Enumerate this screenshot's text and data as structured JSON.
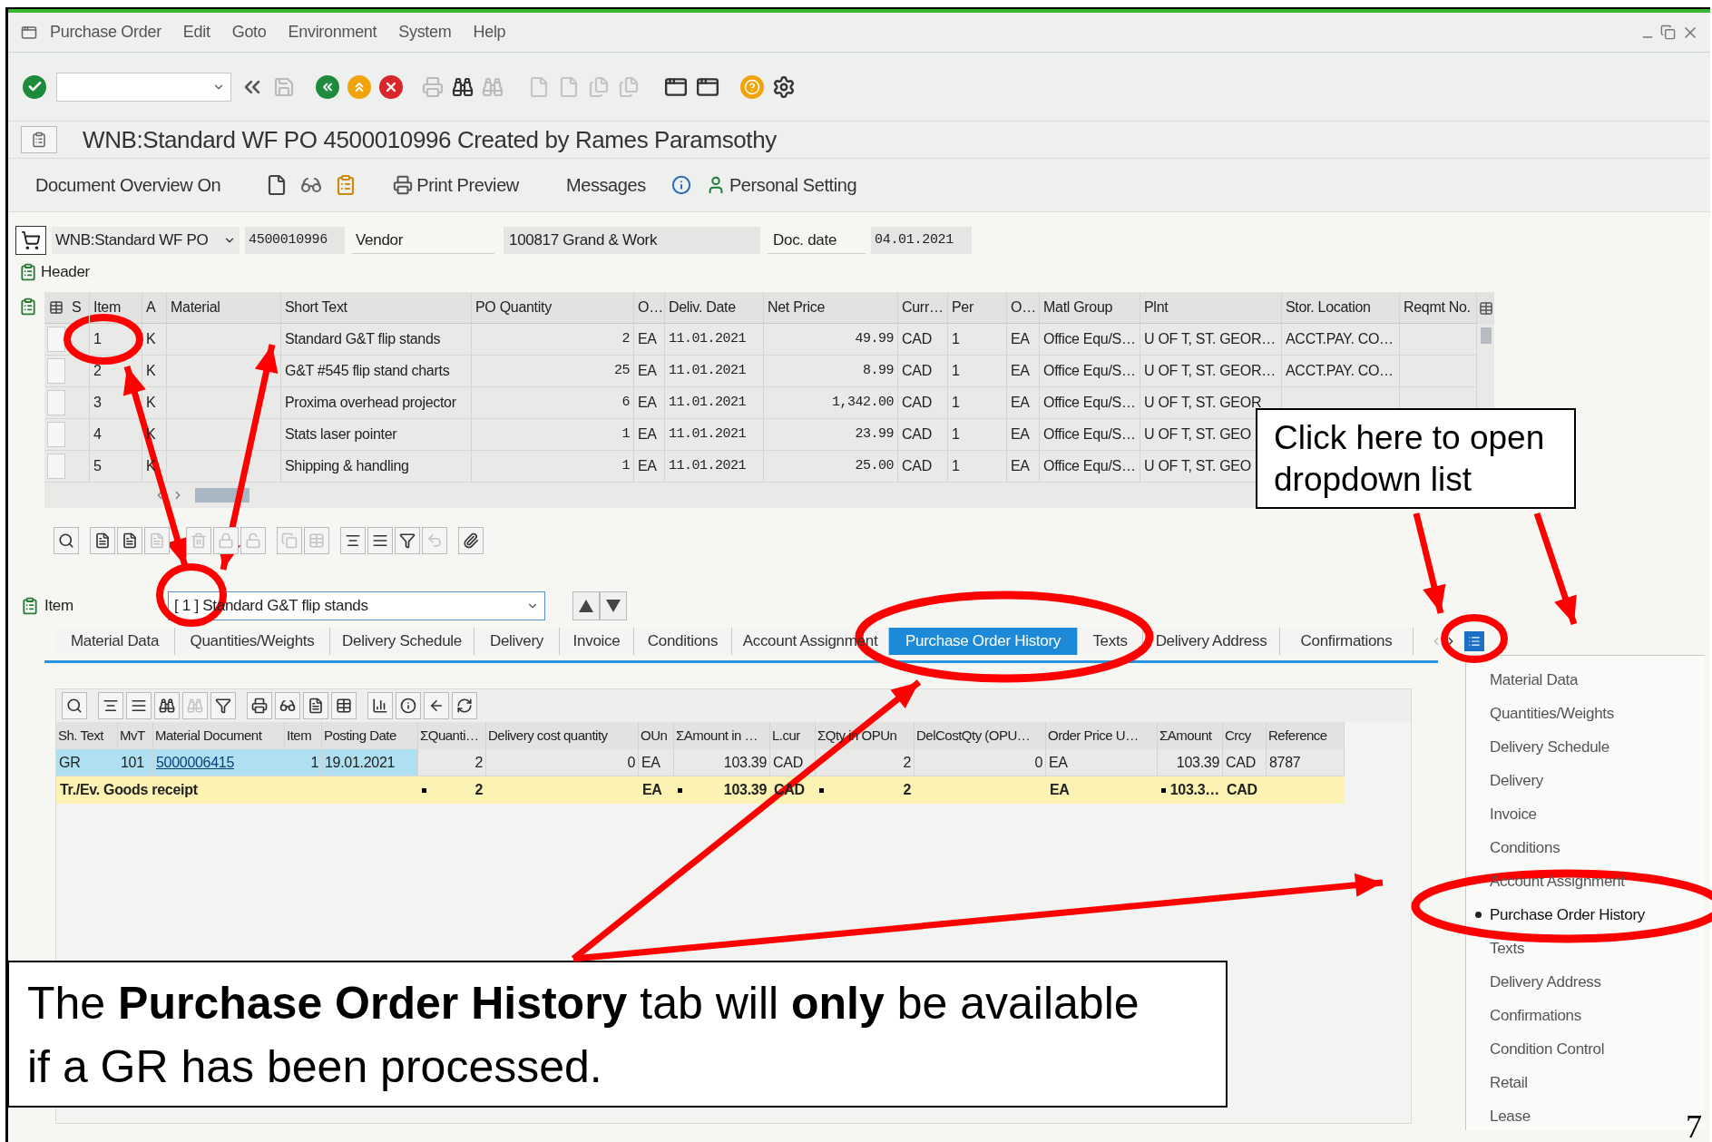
{
  "menu_bar": {
    "items": [
      "Purchase Order",
      "Edit",
      "Goto",
      "Environment",
      "System",
      "Help"
    ]
  },
  "title": "WNB:Standard WF PO 4500010996 Created by Rames Paramsothy",
  "app_toolbar": {
    "items": [
      "Document Overview On",
      "Print Preview",
      "Messages",
      "Personal Setting"
    ]
  },
  "header": {
    "doc_type": "WNB:Standard WF PO",
    "po_number": "4500010996",
    "vendor_label": "Vendor",
    "vendor": "100817 Grand & Work",
    "doc_date_label": "Doc. date",
    "doc_date": "04.01.2021",
    "section_label": "Header"
  },
  "items_table": {
    "columns": [
      "S",
      "Item",
      "A",
      "Material",
      "Short Text",
      "PO Quantity",
      "O…",
      "Deliv. Date",
      "Net Price",
      "Curr…",
      "Per",
      "O…",
      "Matl Group",
      "Plnt",
      "Stor. Location",
      "Reqmt No."
    ],
    "rows": [
      {
        "item": "1",
        "a": "K",
        "short_text": "Standard G&T flip stands",
        "po_quantity": "2",
        "order_unit": "EA",
        "deliv_date": "11.01.2021",
        "net_price": "49.99",
        "currency": "CAD",
        "per": "1",
        "order_price_unit": "EA",
        "matl_group": "Office Equ/S…",
        "plant": "U OF T, ST. GEOR…",
        "stor_location": "ACCT.PAY. CO…"
      },
      {
        "item": "2",
        "a": "K",
        "short_text": "G&T #545 flip stand charts",
        "po_quantity": "25",
        "order_unit": "EA",
        "deliv_date": "11.01.2021",
        "net_price": "8.99",
        "currency": "CAD",
        "per": "1",
        "order_price_unit": "EA",
        "matl_group": "Office Equ/S…",
        "plant": "U OF T, ST. GEOR…",
        "stor_location": "ACCT.PAY. CO…"
      },
      {
        "item": "3",
        "a": "K",
        "short_text": "Proxima overhead projector",
        "po_quantity": "6",
        "order_unit": "EA",
        "deliv_date": "11.01.2021",
        "net_price": "1,342.00",
        "currency": "CAD",
        "per": "1",
        "order_price_unit": "EA",
        "matl_group": "Office Equ/S…",
        "plant": "U OF T, ST. GEOR"
      },
      {
        "item": "4",
        "a": "K",
        "short_text": "Stats laser pointer",
        "po_quantity": "1",
        "order_unit": "EA",
        "deliv_date": "11.01.2021",
        "net_price": "23.99",
        "currency": "CAD",
        "per": "1",
        "order_price_unit": "EA",
        "matl_group": "Office Equ/S…",
        "plant": "U OF T, ST. GEO"
      },
      {
        "item": "5",
        "a": "K",
        "short_text": "Shipping & handling",
        "po_quantity": "1",
        "order_unit": "EA",
        "deliv_date": "11.01.2021",
        "net_price": "25.00",
        "currency": "CAD",
        "per": "1",
        "order_price_unit": "EA",
        "matl_group": "Office Equ/S…",
        "plant": "U OF T, ST. GEO"
      }
    ]
  },
  "item_selector": {
    "label": "Item",
    "value": "[ 1 ] Standard G&T flip stands"
  },
  "tabs": [
    {
      "label": "Material Data",
      "selected": false
    },
    {
      "label": "Quantities/Weights",
      "selected": false
    },
    {
      "label": "Delivery Schedule",
      "selected": false
    },
    {
      "label": "Delivery",
      "selected": false
    },
    {
      "label": "Invoice",
      "selected": false
    },
    {
      "label": "Conditions",
      "selected": false
    },
    {
      "label": "Account Assignment",
      "selected": false
    },
    {
      "label": "Purchase Order History",
      "selected": true
    },
    {
      "label": "Texts",
      "selected": false
    },
    {
      "label": "Delivery Address",
      "selected": false
    },
    {
      "label": "Confirmations",
      "selected": false
    }
  ],
  "history_table": {
    "columns": [
      "Sh. Text",
      "MvT",
      "Material Document",
      "Item",
      "Posting Date",
      "ΣQuanti…",
      "Delivery cost quantity",
      "OUn",
      "ΣAmount in …",
      "L.cur",
      "ΣQty in OPUn",
      "DelCostQty (OPU…",
      "Order Price U…",
      "ΣAmount",
      "Crcy",
      "Reference"
    ],
    "rows": [
      {
        "sh_text": "GR",
        "mvt": "101",
        "material_document": "5000006415",
        "item": "1",
        "posting_date": "19.01.2021",
        "quantity": "2",
        "delivery_cost_quantity": "0",
        "oun": "EA",
        "amount": "103.39",
        "l_cur": "CAD",
        "qty_opun": "2",
        "delcostqty": "0",
        "order_price_unit": "EA",
        "amount_doc": "103.39",
        "crcy": "CAD",
        "reference": "8787"
      }
    ],
    "total": {
      "label": "Tr./Ev. Goods receipt",
      "cells": {
        "quantity": {
          "text": "2",
          "sum": true
        },
        "oun": {
          "text": "EA",
          "sum": false
        },
        "amount": {
          "text": "103.39",
          "sum": true
        },
        "l_cur": {
          "text": "CAD",
          "sum": false
        },
        "qty_opun": {
          "text": "2",
          "sum": true
        },
        "order_price_unit": {
          "text": "EA",
          "sum": false
        },
        "amount_doc": {
          "text": "103.3…",
          "sum": true
        },
        "crcy": {
          "text": "CAD",
          "sum": false
        }
      }
    }
  },
  "tab_menu": {
    "items": [
      {
        "label": "Material Data",
        "selected": false
      },
      {
        "label": "Quantities/Weights",
        "selected": false
      },
      {
        "label": "Delivery Schedule",
        "selected": false
      },
      {
        "label": "Delivery",
        "selected": false
      },
      {
        "label": "Invoice",
        "selected": false
      },
      {
        "label": "Conditions",
        "selected": false
      },
      {
        "label": "Account Assignment",
        "selected": false
      },
      {
        "label": "Purchase Order History",
        "selected": true
      },
      {
        "label": "Texts",
        "selected": false
      },
      {
        "label": "Delivery Address",
        "selected": false
      },
      {
        "label": "Confirmations",
        "selected": false
      },
      {
        "label": "Condition Control",
        "selected": false
      },
      {
        "label": "Retail",
        "selected": false
      },
      {
        "label": "Lease",
        "selected": false
      }
    ]
  },
  "callouts": [
    "Click here to open dropdown list",
    "The **Purchase Order History** tab will **only** be available if a GR has been processed."
  ],
  "page_number": "7"
}
